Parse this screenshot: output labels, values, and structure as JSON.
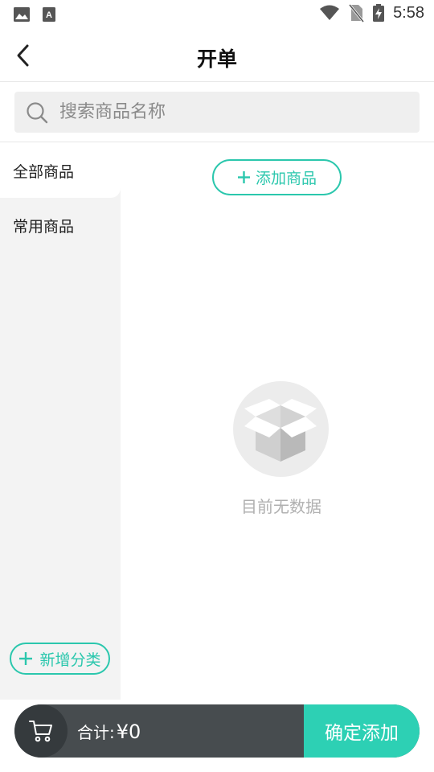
{
  "status_bar": {
    "time": "5:58",
    "icons": [
      "image-icon",
      "a-text-icon",
      "wifi-icon",
      "no-sim-icon",
      "battery-charging-icon"
    ]
  },
  "header": {
    "title": "开单",
    "back_icon": "chevron-left-icon"
  },
  "search": {
    "placeholder": "搜索商品名称",
    "value": ""
  },
  "sidebar": {
    "items": [
      {
        "label": "全部商品",
        "active": true
      },
      {
        "label": "常用商品",
        "active": false
      }
    ],
    "add_category_label": "新增分类"
  },
  "content": {
    "add_goods_label": "添加商品",
    "empty_text": "目前无数据"
  },
  "bottom_bar": {
    "total_label": "合计:",
    "total_value": "¥0",
    "confirm_label": "确定添加"
  },
  "colors": {
    "accent": "#2bc7ad",
    "confirm_bg": "#2dd0b4",
    "bar_bg": "#474c4f",
    "sidebar_bg": "#f3f3f3"
  }
}
